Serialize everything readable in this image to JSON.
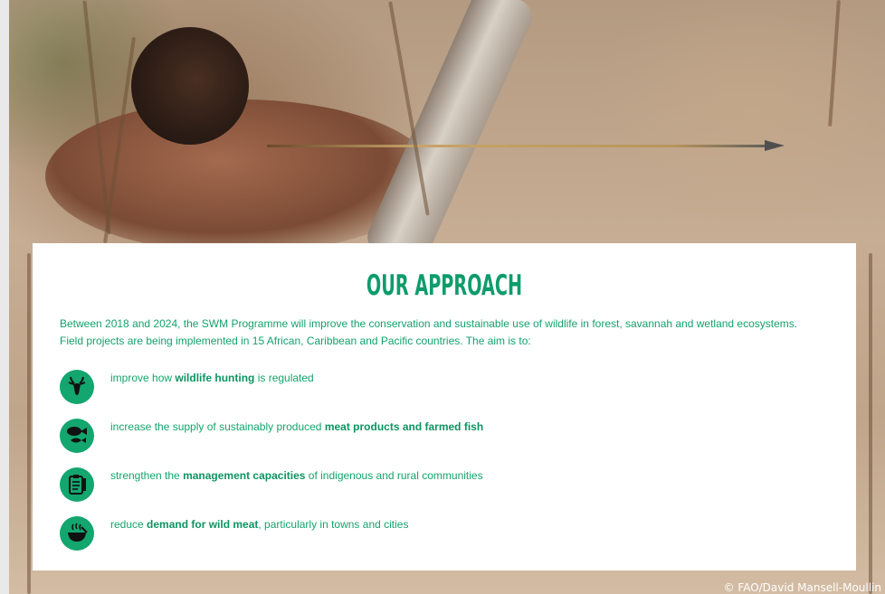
{
  "photo_credit": "© FAO/David Mansell-Moullin",
  "section": {
    "title": "OUR APPROACH",
    "intro_line1": "Between 2018 and 2024, the SWM Programme will improve the conservation and sustainable use of wildlife in forest, savannah and wetland ecosystems.",
    "intro_line2": "Field projects are being implemented in 15 African, Caribbean and Pacific countries. The aim is to:"
  },
  "goals": [
    {
      "icon": "antelope-icon",
      "before": "improve how ",
      "bold": "wildlife hunting",
      "after": " is regulated"
    },
    {
      "icon": "meat-and-fish-icon",
      "before": "increase the supply of sustainably produced ",
      "bold": "meat products and farmed fish",
      "after": ""
    },
    {
      "icon": "clipboard-icon",
      "before": "strengthen the ",
      "bold": "management capacities",
      "after": " of indigenous and rural communities"
    },
    {
      "icon": "cooking-pot-icon",
      "before": "reduce ",
      "bold": "demand for wild meat",
      "after": ", particularly in towns and cities"
    }
  ],
  "colors": {
    "accent": "#13a66f",
    "text": "#14a46e",
    "card": "#ffffff"
  }
}
